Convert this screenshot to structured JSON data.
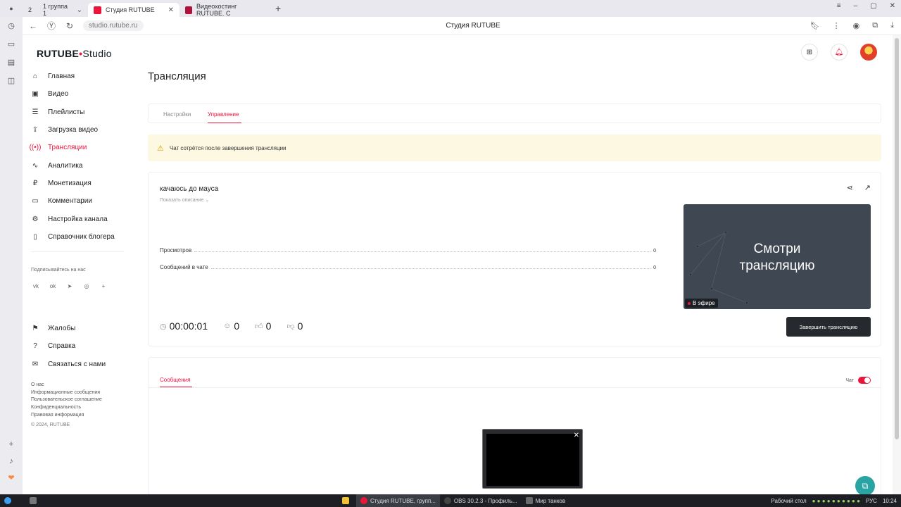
{
  "browser": {
    "tabs": [
      {
        "label": "2"
      },
      {
        "label": "1 группа 1"
      },
      {
        "label": "Студия RUTUBE"
      },
      {
        "label": "Видеохостинг RUTUBE. С"
      }
    ],
    "add_tab": "+",
    "url": "studio.rutube.ru",
    "center_title": "Студия RUTUBE"
  },
  "logo": {
    "brand": "RUTUBE",
    "suffix": "Studio"
  },
  "sidebar": {
    "items": [
      {
        "label": "Главная",
        "icon": "home-icon"
      },
      {
        "label": "Видео",
        "icon": "video-icon"
      },
      {
        "label": "Плейлисты",
        "icon": "playlist-icon"
      },
      {
        "label": "Загрузка видео",
        "icon": "upload-icon"
      },
      {
        "label": "Трансляции",
        "icon": "broadcast-icon",
        "active": true
      },
      {
        "label": "Аналитика",
        "icon": "analytics-icon"
      },
      {
        "label": "Монетизация",
        "icon": "money-icon"
      },
      {
        "label": "Комментарии",
        "icon": "comments-icon"
      },
      {
        "label": "Настройка канала",
        "icon": "gear-icon"
      },
      {
        "label": "Справочник блогера",
        "icon": "book-icon"
      }
    ],
    "subscribe_label": "Подписывайтесь на нас",
    "secondary": [
      {
        "label": "Жалобы",
        "icon": "flag-icon"
      },
      {
        "label": "Справка",
        "icon": "help-icon"
      },
      {
        "label": "Связаться с нами",
        "icon": "mail-icon"
      }
    ],
    "links": [
      "О нас",
      "Информационные сообщения",
      "Пользовательское соглашение",
      "Конфиденциальность",
      "Правовая информация"
    ],
    "copyright": "© 2024, RUTUBE"
  },
  "page": {
    "title": "Трансляция",
    "tabs": [
      "Настройки",
      "Управление"
    ],
    "warning": "Чат сотрётся после завершения трансляции"
  },
  "stream": {
    "name": "качаюсь до мауса",
    "show_description": "Показать описание",
    "views_label": "Просмотров",
    "views_value": "0",
    "chat_label": "Сообщений в чате",
    "chat_value": "0",
    "timer": "00:00:01",
    "viewers": "0",
    "likes": "0",
    "dislikes": "0",
    "preview_line1": "Смотри",
    "preview_line2": "трансляцию",
    "live_badge": "В эфире",
    "end_button": "Завершить трансляцию"
  },
  "messages": {
    "tab": "Сообщения",
    "chat_label": "Чат",
    "chat_enabled": true
  },
  "taskbar": {
    "items": [
      "Студия RUTUBE, групп...",
      "OBS 30.2.3 - Профиль...",
      "Мир танков"
    ],
    "desktop": "Рабочий стол",
    "lang": "РУС",
    "time": "10:24"
  },
  "colors": {
    "accent": "#ed143b",
    "dark_button": "#26292e",
    "warning_bg": "#fdf8e1"
  }
}
